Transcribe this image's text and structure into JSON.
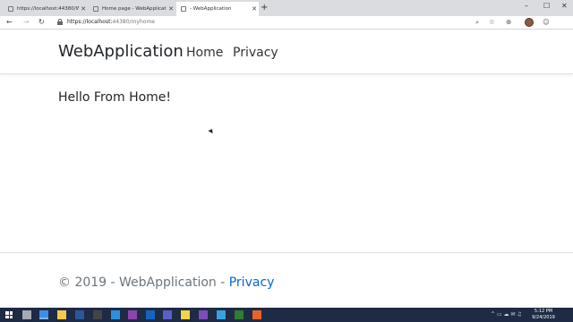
{
  "browser": {
    "tabs": [
      {
        "title": "https://localhost:44380/WebAp"
      },
      {
        "title": "Home page - WebApplication"
      },
      {
        "title": "- WebApplication"
      }
    ],
    "new_tab_symbol": "+",
    "window_controls": {
      "minimize": "–",
      "maximize": "☐",
      "close": "✕"
    },
    "address": {
      "host": "https://localhost:",
      "path": "44380/myhome"
    },
    "nav_buttons": {
      "back": "←",
      "forward": "→",
      "refresh": "↻"
    },
    "tools": {
      "zoom": "⌕",
      "favorite": "☆",
      "collections": "⊕",
      "menu": "☺"
    }
  },
  "site": {
    "brand": "WebApplication",
    "nav": [
      {
        "label": "Home"
      },
      {
        "label": "Privacy"
      }
    ],
    "main_text": "Hello From Home!",
    "footer": {
      "prefix": "© 2019 - WebApplication - ",
      "link": "Privacy"
    }
  },
  "taskbar": {
    "clock_time": "5:12 PM",
    "clock_date": "9/24/2019",
    "tray": "^ ▭ ☁ ✉ ♫",
    "apps": [
      {
        "name": "task-view-icon",
        "color": "#ffffff"
      },
      {
        "name": "edge-icon",
        "color": "#3c8ee8"
      },
      {
        "name": "file-explorer-icon",
        "color": "#f2c94c"
      },
      {
        "name": "powershell-icon",
        "color": "#2b5797"
      },
      {
        "name": "terminal-icon",
        "color": "#444444"
      },
      {
        "name": "vscode-icon",
        "color": "#2d8fe0"
      },
      {
        "name": "onenote-icon",
        "color": "#8e44ad"
      },
      {
        "name": "outlook-icon",
        "color": "#1565c0"
      },
      {
        "name": "teams-icon",
        "color": "#5b5fc7"
      },
      {
        "name": "sticky-notes-icon",
        "color": "#f5d547"
      },
      {
        "name": "visual-studio-icon",
        "color": "#7c4dbd"
      },
      {
        "name": "paint-icon",
        "color": "#3aa0e0"
      },
      {
        "name": "edge-dev-icon",
        "color": "#2e7d32"
      },
      {
        "name": "firefox-icon",
        "color": "#e8632a"
      }
    ]
  }
}
